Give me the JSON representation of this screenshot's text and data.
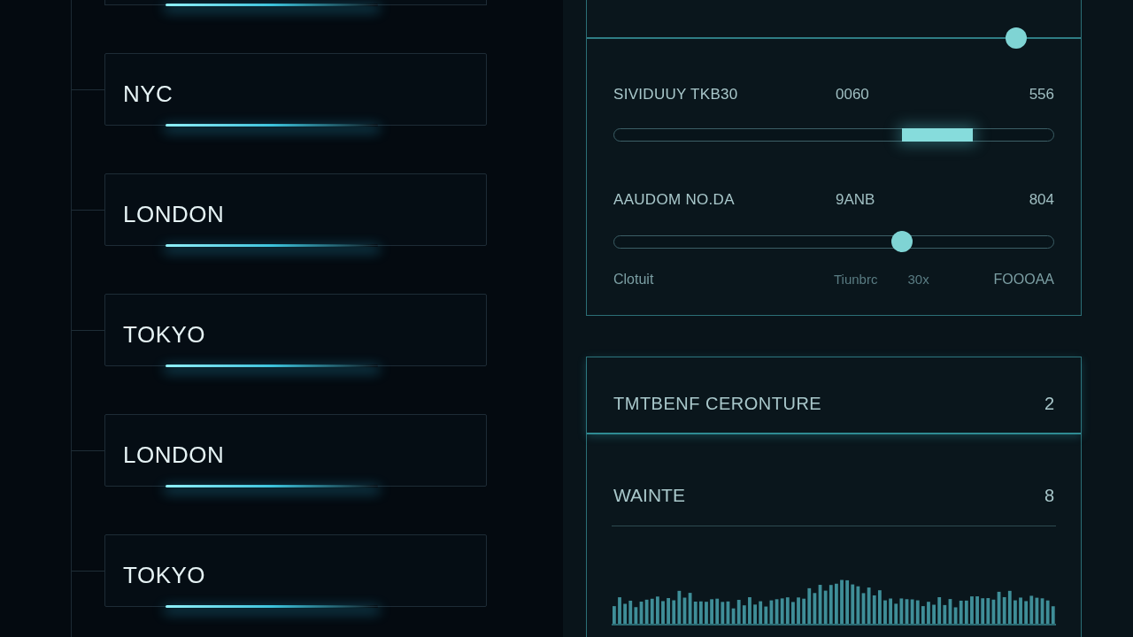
{
  "location_tree": {
    "cards": [
      {
        "label": "NYC"
      },
      {
        "label": "LONDON"
      },
      {
        "label": "TOKYO"
      },
      {
        "label": "LONDON"
      },
      {
        "label": "TOKYO"
      }
    ]
  },
  "controls_panel": {
    "top_slider": {
      "level": 0.87
    },
    "sliders": [
      {
        "kind": "range",
        "label": "SIVIDUUY TKB30",
        "column_2": "0060",
        "column_3": "556",
        "level": 0.735
      },
      {
        "kind": "knob",
        "label": "AAUDOM NO.DA",
        "column_2": "9ANB",
        "column_3": "804",
        "level": 0.655
      }
    ],
    "footer": [
      "Clotuit",
      "Tiunbrc",
      "30x",
      "FOOOAA"
    ]
  },
  "info_panel": {
    "header": {
      "title": "TMTBENF CERONTURE",
      "count": "2"
    },
    "row": {
      "title": "WAINTE",
      "count": "8"
    }
  }
}
